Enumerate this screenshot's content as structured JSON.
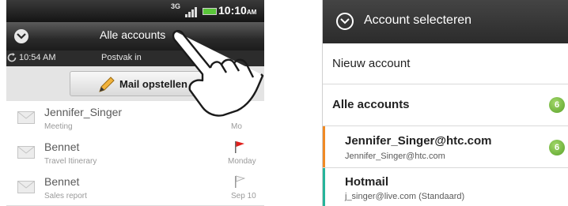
{
  "left_screen": {
    "status_bar": {
      "network": "3G",
      "time": "10:10",
      "time_suffix": "AM"
    },
    "account_bar": {
      "title": "Alle accounts"
    },
    "sync_bar": {
      "last_sync": "10:54 AM",
      "folder": "Postvak in"
    },
    "compose": {
      "label": "Mail opstellen"
    },
    "messages": [
      {
        "sender": "Jennifer_Singer",
        "subject": "Meeting",
        "date": "Mo",
        "flag": "none"
      },
      {
        "sender": "Bennet",
        "subject": "Travel Itinerary",
        "date": "Monday",
        "flag": "red"
      },
      {
        "sender": "Bennet",
        "subject": "Sales report",
        "date": "Sep 10",
        "flag": "grey"
      }
    ],
    "colors": {
      "flag_red": "#e0201c",
      "battery": "#5ac63a"
    }
  },
  "right_screen": {
    "dialog_title": "Account selecteren",
    "new_account_label": "Nieuw account",
    "accounts": {
      "all": {
        "label": "Alle accounts",
        "count": "6"
      },
      "jennifer": {
        "name": "Jennifer_Singer@htc.com",
        "email": "Jennifer_Singer@htc.com",
        "count": "6",
        "stripe_color": "#f08a24"
      },
      "hotmail": {
        "name": "Hotmail",
        "email": "j_singer@live.com (Standaard)",
        "stripe_color": "#26b49a"
      }
    }
  }
}
